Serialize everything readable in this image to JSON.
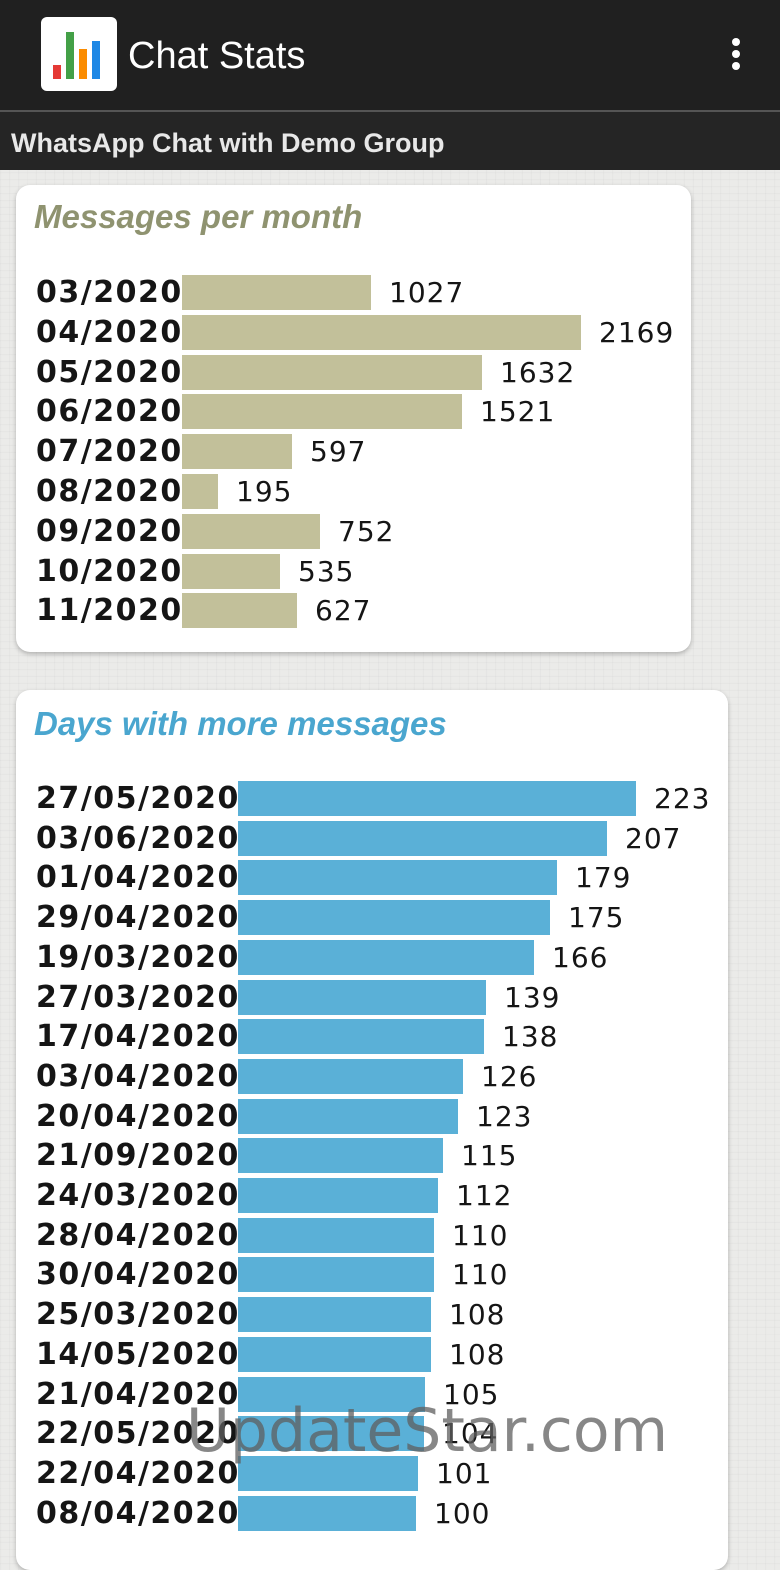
{
  "appbar": {
    "title": "Chat Stats",
    "icon": "bar-chart-logo-icon",
    "menu_icon": "more-vert-icon"
  },
  "subtitle": "WhatsApp Chat with Demo Group",
  "colors": {
    "monthly_bar": "#c2c09a",
    "monthly_title": "#8f9370",
    "daily_bar": "#5ab0d7",
    "daily_title": "#4aa6cf"
  },
  "monthly": {
    "title": "Messages per month",
    "rows": [
      {
        "label": "03/2020",
        "value": 1027
      },
      {
        "label": "04/2020",
        "value": 2169
      },
      {
        "label": "05/2020",
        "value": 1632
      },
      {
        "label": "06/2020",
        "value": 1521
      },
      {
        "label": "07/2020",
        "value": 597
      },
      {
        "label": "08/2020",
        "value": 195
      },
      {
        "label": "09/2020",
        "value": 752
      },
      {
        "label": "10/2020",
        "value": 535
      },
      {
        "label": "11/2020",
        "value": 627
      }
    ]
  },
  "daily": {
    "title": "Days with more messages",
    "rows": [
      {
        "label": "27/05/2020",
        "value": 223
      },
      {
        "label": "03/06/2020",
        "value": 207
      },
      {
        "label": "01/04/2020",
        "value": 179
      },
      {
        "label": "29/04/2020",
        "value": 175
      },
      {
        "label": "19/03/2020",
        "value": 166
      },
      {
        "label": "27/03/2020",
        "value": 139
      },
      {
        "label": "17/04/2020",
        "value": 138
      },
      {
        "label": "03/04/2020",
        "value": 126
      },
      {
        "label": "20/04/2020",
        "value": 123
      },
      {
        "label": "21/09/2020",
        "value": 115
      },
      {
        "label": "24/03/2020",
        "value": 112
      },
      {
        "label": "28/04/2020",
        "value": 110
      },
      {
        "label": "30/04/2020",
        "value": 110
      },
      {
        "label": "25/03/2020",
        "value": 108
      },
      {
        "label": "14/05/2020",
        "value": 108
      },
      {
        "label": "21/04/2020",
        "value": 105
      },
      {
        "label": "22/05/2020",
        "value": 104
      },
      {
        "label": "22/04/2020",
        "value": 101
      },
      {
        "label": "08/04/2020",
        "value": 100
      }
    ]
  },
  "chart_data": [
    {
      "type": "bar",
      "title": "Messages per month",
      "categories": [
        "03/2020",
        "04/2020",
        "05/2020",
        "06/2020",
        "07/2020",
        "08/2020",
        "09/2020",
        "10/2020",
        "11/2020"
      ],
      "values": [
        1027,
        2169,
        1632,
        1521,
        597,
        195,
        752,
        535,
        627
      ]
    },
    {
      "type": "bar",
      "title": "Days with more messages",
      "categories": [
        "27/05/2020",
        "03/06/2020",
        "01/04/2020",
        "29/04/2020",
        "19/03/2020",
        "27/03/2020",
        "17/04/2020",
        "03/04/2020",
        "20/04/2020",
        "21/09/2020",
        "24/03/2020",
        "28/04/2020",
        "30/04/2020",
        "25/03/2020",
        "14/05/2020",
        "21/04/2020",
        "22/05/2020",
        "22/04/2020",
        "08/04/2020"
      ],
      "values": [
        223,
        207,
        179,
        175,
        166,
        139,
        138,
        126,
        123,
        115,
        112,
        110,
        110,
        108,
        108,
        105,
        104,
        101,
        100
      ]
    }
  ],
  "watermark": "UpdateStar.com"
}
